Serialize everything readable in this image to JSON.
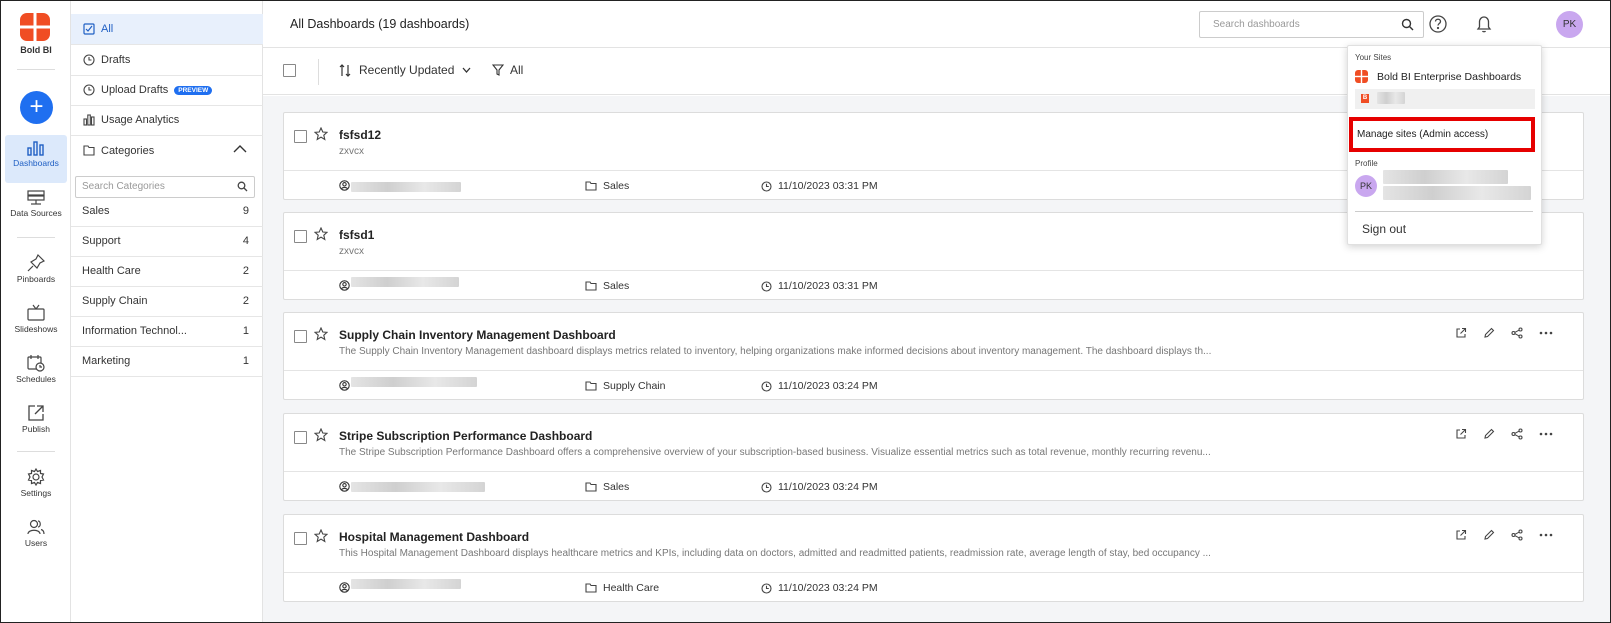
{
  "app": {
    "logo_text": "Bold BI",
    "brand_colors": {
      "logo": "#f04d23",
      "accent": "#1f6ff0",
      "highlight": "#e60000",
      "avatar": "#c9a7ef"
    }
  },
  "rail": {
    "add_label": "+",
    "items": [
      {
        "label": "Dashboards",
        "icon": "bar-chart-icon"
      },
      {
        "label": "Data Sources",
        "icon": "database-icon"
      },
      {
        "label": "Pinboards",
        "icon": "pin-icon"
      },
      {
        "label": "Slideshows",
        "icon": "tv-icon"
      },
      {
        "label": "Schedules",
        "icon": "calendar-clock-icon"
      },
      {
        "label": "Publish",
        "icon": "publish-icon"
      },
      {
        "label": "Settings",
        "icon": "gear-icon"
      },
      {
        "label": "Users",
        "icon": "users-icon"
      }
    ]
  },
  "categories_panel": {
    "all": "All",
    "drafts": "Drafts",
    "upload_drafts": "Upload Drafts",
    "preview_badge": "PREVIEW",
    "usage_analytics": "Usage Analytics",
    "categories": "Categories",
    "search_placeholder": "Search Categories",
    "items": [
      {
        "name": "Sales",
        "count": "9"
      },
      {
        "name": "Support",
        "count": "4"
      },
      {
        "name": "Health Care",
        "count": "2"
      },
      {
        "name": "Supply Chain",
        "count": "2"
      },
      {
        "name": "Information Technol...",
        "count": "1"
      },
      {
        "name": "Marketing",
        "count": "1"
      }
    ]
  },
  "header": {
    "title": "All Dashboards (19 dashboards)",
    "search_placeholder": "Search dashboards",
    "avatar": "PK"
  },
  "toolbar": {
    "sort_label": "Recently Updated",
    "filter_label": "All"
  },
  "dashboards": [
    {
      "title": "fsfsd12",
      "desc": "zxvcx",
      "category": "Sales",
      "date": "11/10/2023 03:31 PM"
    },
    {
      "title": "fsfsd1",
      "desc": "zxvcx",
      "category": "Sales",
      "date": "11/10/2023 03:31 PM"
    },
    {
      "title": "Supply Chain Inventory Management Dashboard",
      "desc": "The Supply Chain Inventory Management dashboard displays metrics related to inventory, helping organizations make informed decisions about inventory management. The dashboard displays th...",
      "category": "Supply Chain",
      "date": "11/10/2023 03:24 PM"
    },
    {
      "title": "Stripe Subscription Performance Dashboard",
      "desc": "The Stripe Subscription Performance Dashboard offers a comprehensive overview of your subscription-based business. Visualize essential metrics such as total revenue, monthly recurring revenu...",
      "category": "Sales",
      "date": "11/10/2023 03:24 PM"
    },
    {
      "title": "Hospital Management Dashboard",
      "desc": "This Hospital Management Dashboard displays healthcare metrics and KPIs, including data on doctors, admitted and readmitted patients, readmission rate, average length of stay, bed occupancy ...",
      "category": "Health Care",
      "date": "11/10/2023 03:24 PM"
    }
  ],
  "dropdown": {
    "your_sites": "Your Sites",
    "site_name": "Bold BI Enterprise Dashboards",
    "manage_sites": "Manage sites (Admin access)",
    "profile": "Profile",
    "avatar": "PK",
    "sign_out": "Sign out"
  }
}
